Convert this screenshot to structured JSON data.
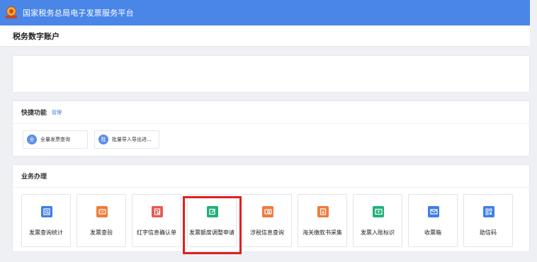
{
  "header": {
    "title": "国家税务总局电子发票服务平台",
    "logo": "tax-emblem"
  },
  "account": {
    "title": "税务数字账户"
  },
  "quick": {
    "title": "快捷功能",
    "manage_label": "管理",
    "items": [
      {
        "badge": "全",
        "label": "全量发票查询"
      },
      {
        "badge": "批",
        "label": "批量导入导出进..."
      }
    ]
  },
  "business": {
    "title": "业务办理",
    "tiles": [
      {
        "label": "发票查询统计",
        "icon": "search-doc-icon",
        "color": "#3f7fe6"
      },
      {
        "label": "发票查验",
        "icon": "ticket-icon",
        "color": "#ee7c3b"
      },
      {
        "label": "红字信息确认单",
        "icon": "red-letter-doc-icon",
        "color": "#e65a52"
      },
      {
        "label": "发票额度调整申请",
        "icon": "edit-doc-icon",
        "color": "#20b07a"
      },
      {
        "label": "涉税信息查询",
        "icon": "tax-info-search-icon",
        "color": "#ee7c3b"
      },
      {
        "label": "海关缴款书采集",
        "icon": "download-doc-icon",
        "color": "#ee7c3b"
      },
      {
        "label": "发票入账标识",
        "icon": "invoice-tag-icon",
        "color": "#20b07a"
      },
      {
        "label": "收票箱",
        "icon": "mail-icon",
        "color": "#3f7fe6"
      },
      {
        "label": "助信码",
        "icon": "qr-code-icon",
        "color": "#3f7fe6"
      }
    ],
    "highlighted_tile": "发票额度调整申请",
    "highlight_color": "#e02020"
  },
  "colors": {
    "header_bg": "#4a86e8",
    "page_bg": "#eef0f3"
  }
}
